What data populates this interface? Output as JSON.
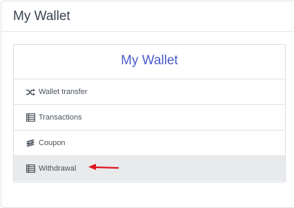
{
  "page": {
    "title": "My Wallet"
  },
  "card": {
    "title": "My Wallet"
  },
  "menu": {
    "items": [
      {
        "label": "Wallet transfer",
        "icon": "shuffle-icon"
      },
      {
        "label": "Transactions",
        "icon": "table-list-icon"
      },
      {
        "label": "Coupon",
        "icon": "money-stack-icon"
      },
      {
        "label": "Withdrawal",
        "icon": "table-list-icon",
        "active": true
      }
    ]
  },
  "colors": {
    "accent": "#4a5bc9",
    "arrow": "#e0141c",
    "active_bg": "#e9eaec"
  },
  "annotation": {
    "icon": "red-arrow-icon"
  }
}
